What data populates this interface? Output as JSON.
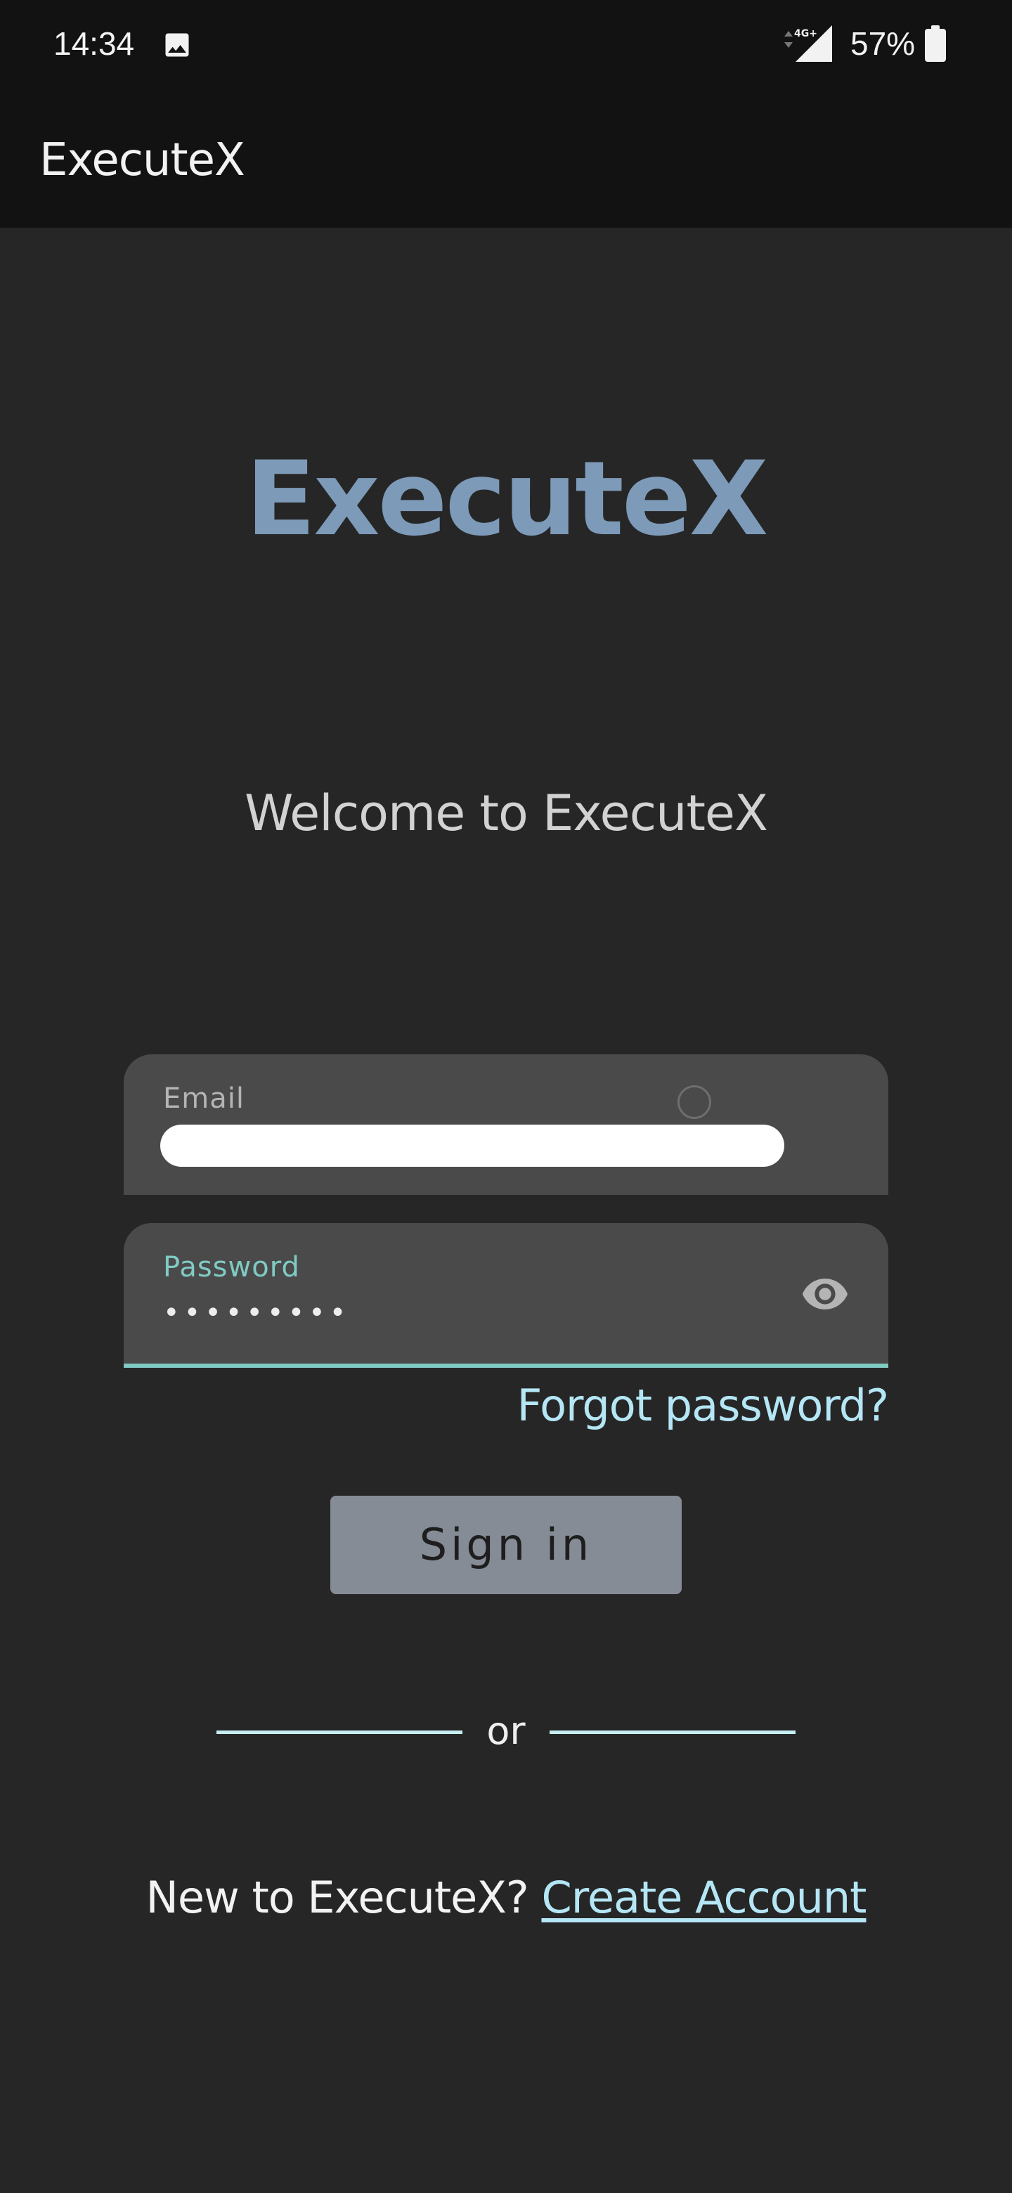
{
  "status_bar": {
    "time": "14:34",
    "network": "4G+",
    "battery": "57%",
    "icons": [
      "gallery-icon",
      "signal-icon",
      "battery-icon"
    ]
  },
  "app_bar": {
    "title": "ExecuteX"
  },
  "logo": {
    "text": "ExecuteX",
    "color": "#7d9ab8"
  },
  "welcome": "Welcome to ExecuteX",
  "form": {
    "email": {
      "label": "Email",
      "value_redacted": true
    },
    "password": {
      "label": "Password",
      "masked_value": "•••••••••",
      "toggle_icon": "eye-icon",
      "focused": true
    },
    "forgot_password": "Forgot password?",
    "sign_in": "Sign in"
  },
  "divider": {
    "text": "or"
  },
  "create_account": {
    "prompt": "New to ExecuteX?",
    "link": "Create Account"
  },
  "colors": {
    "background": "#262626",
    "bar": "#121212",
    "field": "#4a4a4a",
    "accent": "#80cbc4",
    "link": "#b5e6f5",
    "button": "#858c96"
  }
}
